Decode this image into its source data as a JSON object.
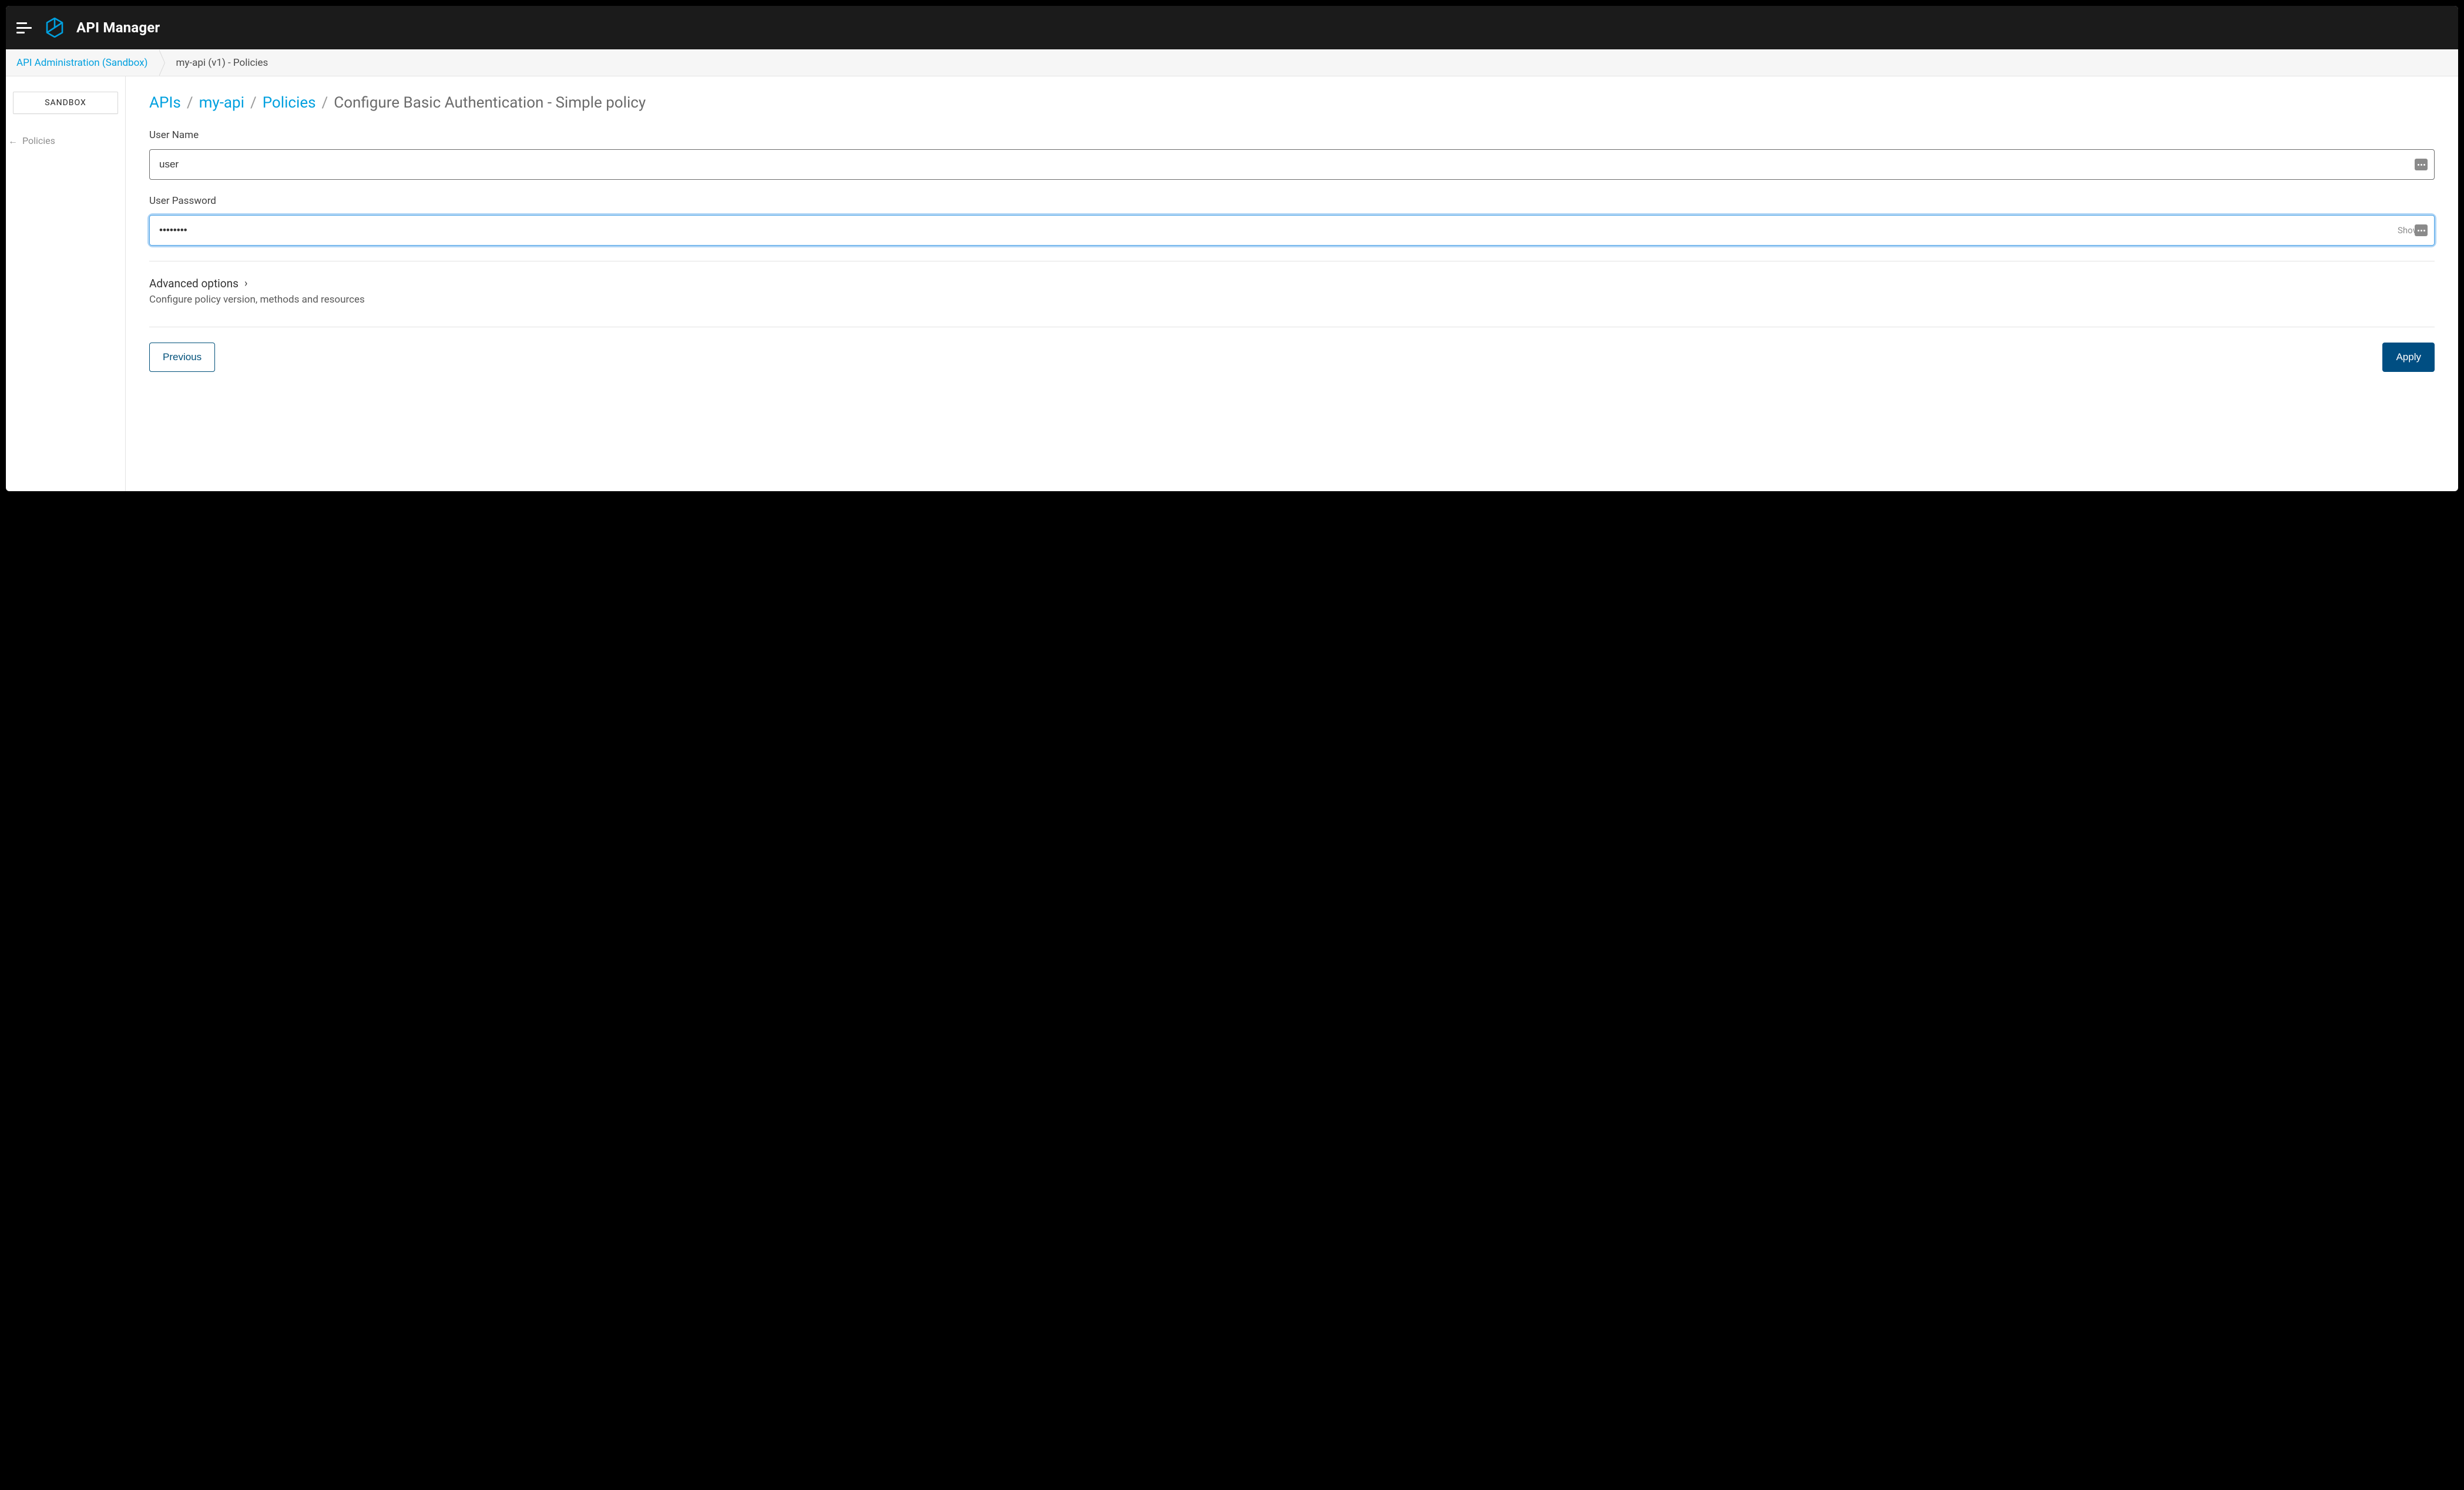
{
  "header": {
    "app_title": "API Manager"
  },
  "breadcrumb_bar": {
    "admin_label": "API Administration (Sandbox)",
    "current_label": "my-api (v1) - Policies"
  },
  "sidebar": {
    "env_label": "SANDBOX",
    "back_link": "Policies"
  },
  "page_crumbs": {
    "c1": "APIs",
    "c2": "my-api",
    "c3": "Policies",
    "current": "Configure Basic Authentication - Simple policy",
    "sep": "/"
  },
  "form": {
    "username_label": "User Name",
    "username_value": "user",
    "password_label": "User Password",
    "password_value": "••••••••",
    "show_label": "Show"
  },
  "advanced": {
    "title": "Advanced options",
    "desc": "Configure policy version, methods and resources"
  },
  "buttons": {
    "previous": "Previous",
    "apply": "Apply"
  }
}
